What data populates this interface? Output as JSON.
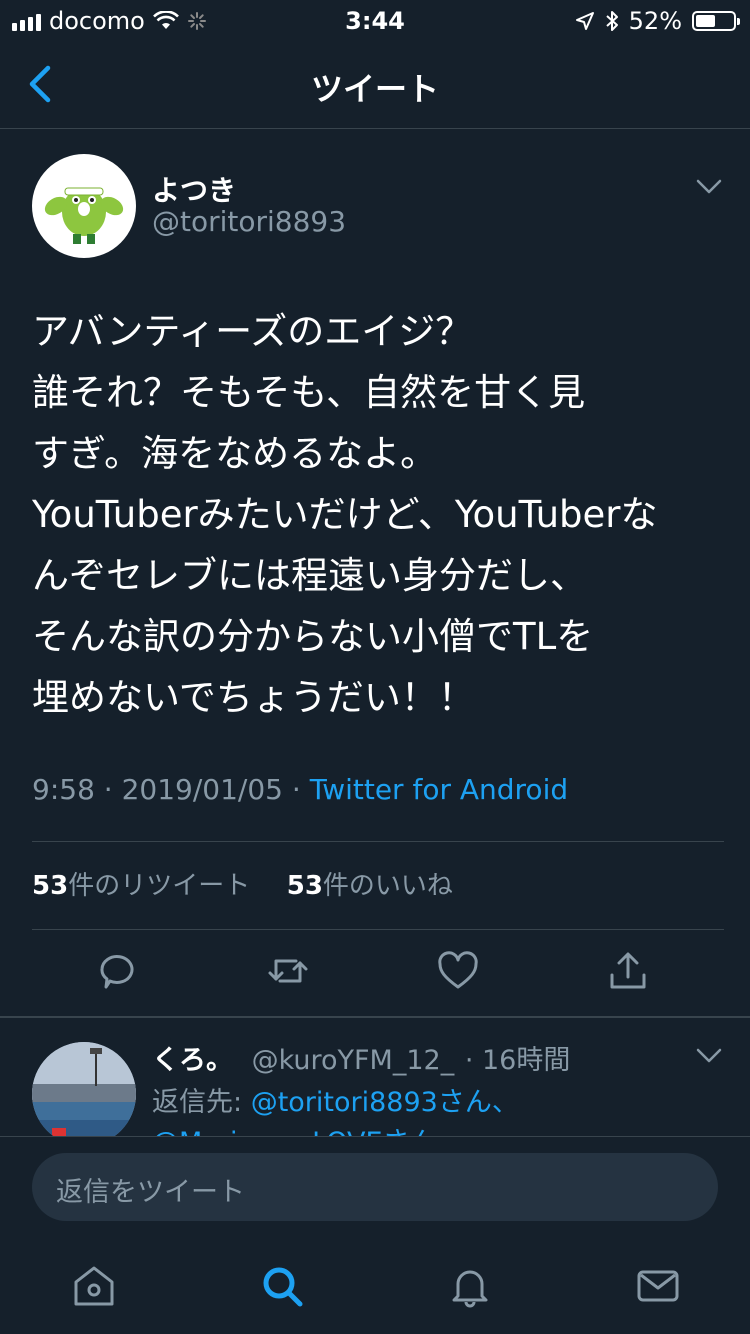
{
  "status_bar": {
    "carrier": "docomo",
    "time": "3:44",
    "battery": "52%",
    "battery_level": 0.52
  },
  "nav": {
    "title": "ツイート"
  },
  "tweet": {
    "author_name": "よつき",
    "author_handle": "@toritori8893",
    "text": "アバンティーズのエイジ？\n誰それ？そもそも、自然を甘く見\nすぎ。海をなめるなよ。\nYouTuberみたいだけど、YouTuberな\nんぞセレブには程遠い身分だし、\nそんな訳の分からない小僧でTLを\n埋めないでちょうだい！！",
    "time": "9:58",
    "dot": "·",
    "date": "2019/01/05",
    "source": "Twitter for Android",
    "retweet_count": "53",
    "retweet_label": "件のリツイート",
    "like_count": "53",
    "like_label": "件のいいね"
  },
  "reply": {
    "name": "くろ。",
    "handle": "@kuroYFM_12_",
    "time": "· 16時間",
    "reply_to_label": "返信先: ",
    "reply_to_links": "@toritori8893さん、",
    "reply_to_line2": "@Marinos__LOVEさん"
  },
  "compose": {
    "placeholder": "返信をツイート"
  },
  "colors": {
    "background": "#15202b",
    "accent": "#1da1f2",
    "secondary_text": "#8899a6",
    "divider": "#38444d"
  },
  "icons": [
    "back-chevron-icon",
    "caret-down-icon",
    "reply-icon",
    "retweet-icon",
    "like-icon",
    "share-icon",
    "home-icon",
    "search-icon",
    "notifications-icon",
    "messages-icon"
  ]
}
